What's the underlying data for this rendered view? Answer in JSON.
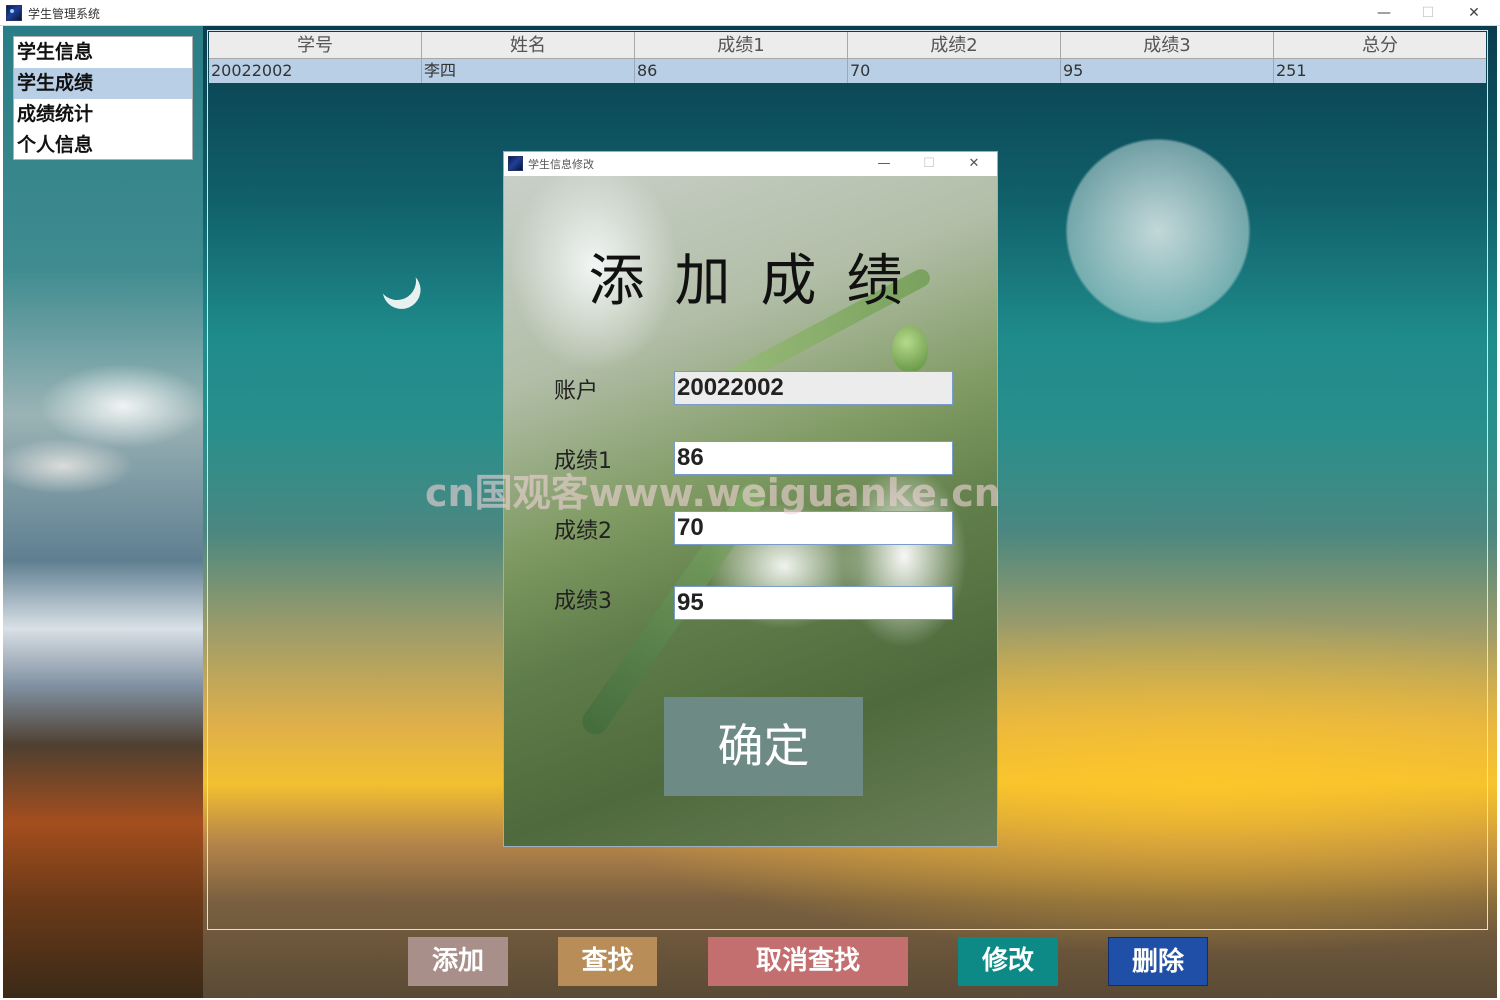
{
  "window": {
    "title": "学生管理系统",
    "min_glyph": "—",
    "max_glyph": "☐",
    "close_glyph": "✕"
  },
  "sidebar": {
    "items": [
      {
        "label": "学生信息",
        "selected": false
      },
      {
        "label": "学生成绩",
        "selected": true
      },
      {
        "label": "成绩统计",
        "selected": false
      },
      {
        "label": "个人信息",
        "selected": false
      }
    ]
  },
  "table": {
    "columns": [
      "学号",
      "姓名",
      "成绩1",
      "成绩2",
      "成绩3",
      "总分"
    ],
    "rows": [
      [
        "20022002",
        "李四",
        "86",
        "70",
        "95",
        "251"
      ]
    ]
  },
  "toolbar": {
    "add_label": "添加",
    "find_label": "查找",
    "cancel_find_label": "取消查找",
    "edit_label": "修改",
    "delete_label": "删除"
  },
  "dialog": {
    "title": "学生信息修改",
    "heading": "添加成绩",
    "fields": {
      "account": {
        "label": "账户",
        "value": "20022002"
      },
      "score1": {
        "label": "成绩1",
        "value": "86"
      },
      "score2": {
        "label": "成绩2",
        "value": "70"
      },
      "score3": {
        "label": "成绩3",
        "value": "95"
      }
    },
    "confirm_label": "确定"
  },
  "watermark": "cn国观客www.weiguanke.cn",
  "colors": {
    "selected_row": "#b8cfe6",
    "add_button": "#a98f89",
    "find_button": "#b98d58",
    "cancel_find_button": "#c46f6f",
    "edit_button": "#0e8a86",
    "delete_button": "#1f4fa6",
    "confirm_button": "#6e8a84"
  },
  "icons": {
    "app_icon": "app-icon",
    "dialog_icon": "app-icon"
  }
}
